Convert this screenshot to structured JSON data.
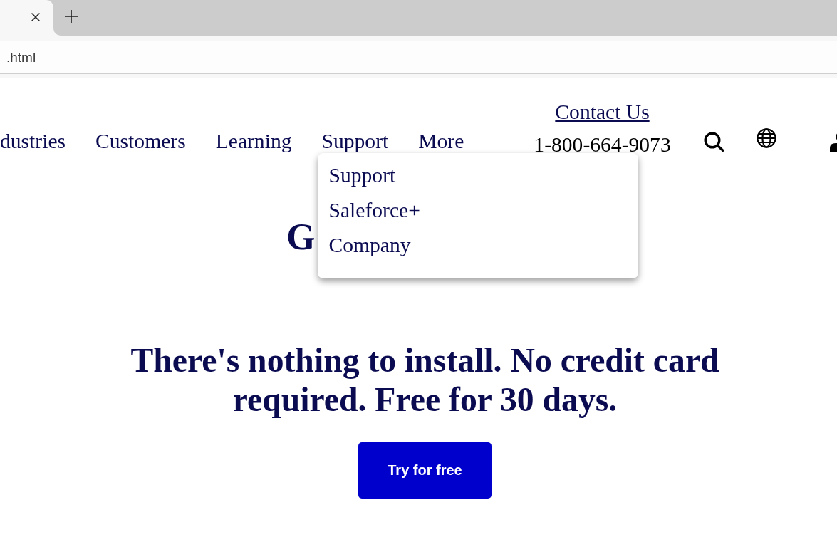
{
  "browser": {
    "address": ".html"
  },
  "nav": {
    "items": [
      {
        "label": "dustries"
      },
      {
        "label": "Customers"
      },
      {
        "label": "Learning"
      },
      {
        "label": "Support",
        "menu": [
          "Support",
          "Saleforce+",
          "Company"
        ]
      },
      {
        "label": "More"
      }
    ]
  },
  "contact": {
    "link": "Contact Us",
    "phone": "1-800-664-9073"
  },
  "hero": {
    "heading": "G",
    "tagline": "There's nothing to install. No credit card required. Free for 30 days.",
    "button": "Try for free"
  }
}
